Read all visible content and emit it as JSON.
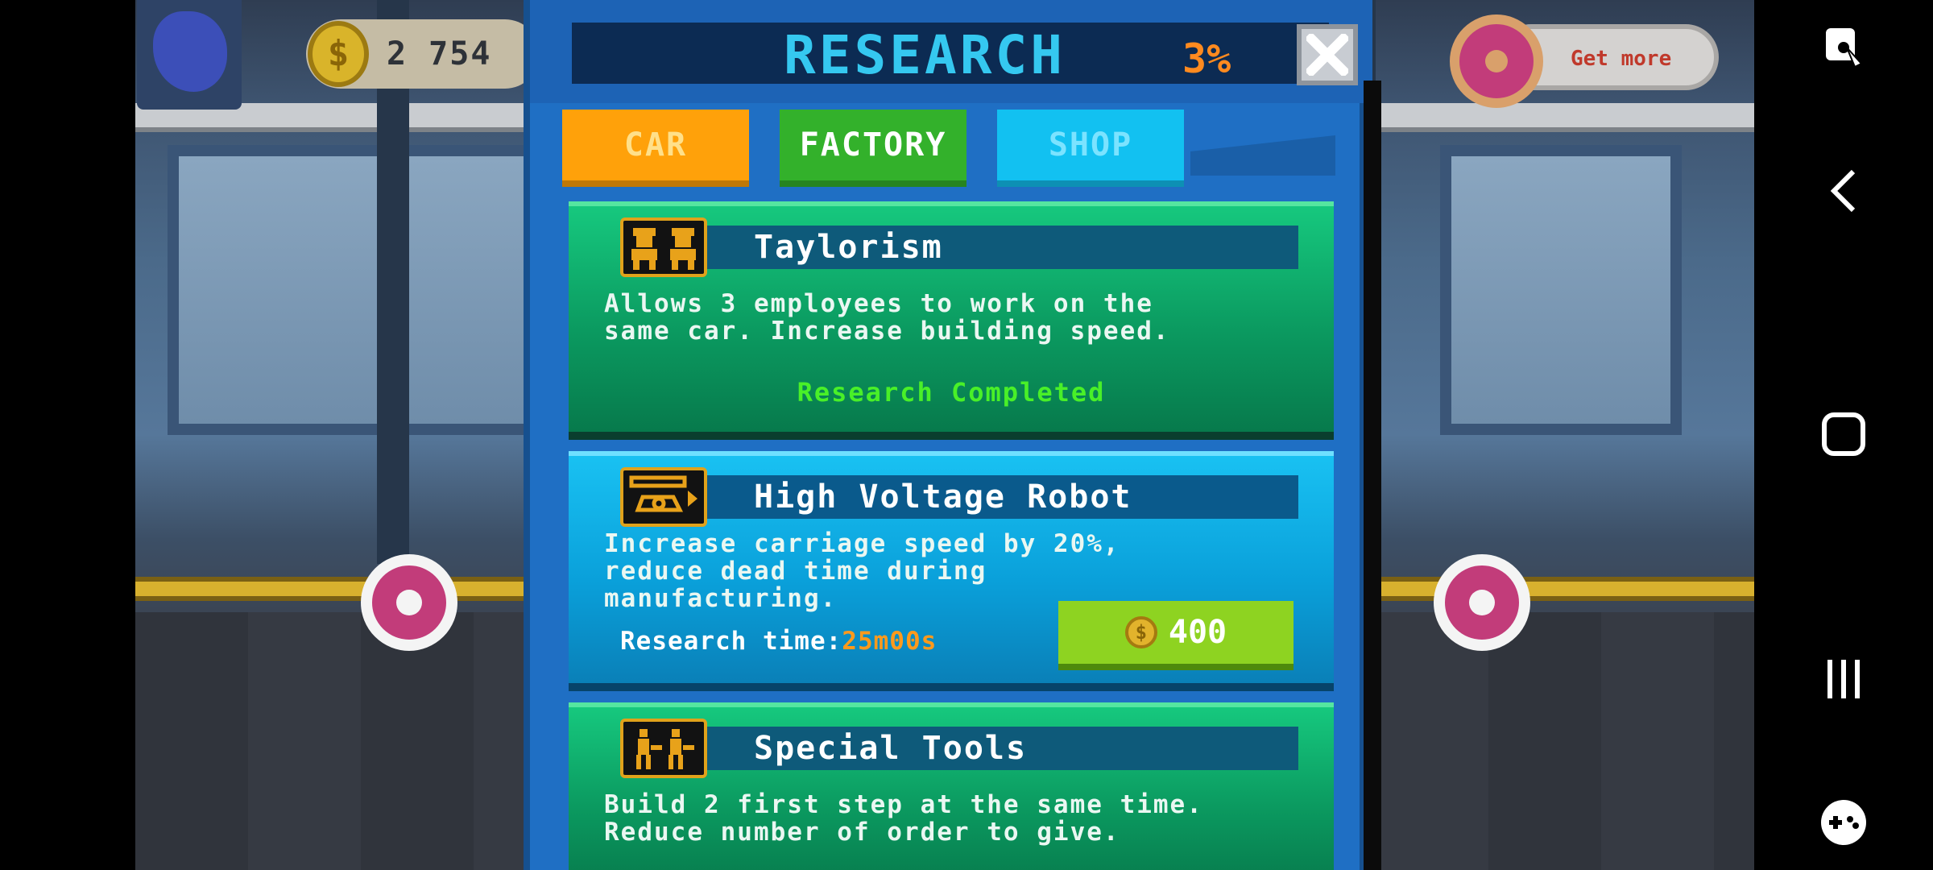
{
  "hud": {
    "coins": "2 754",
    "coin_symbol": "$",
    "get_more_label": "Get more"
  },
  "dialog": {
    "title": "RESEARCH",
    "progress": "3%",
    "close_icon": "close-icon"
  },
  "tabs": [
    {
      "label": "CAR",
      "color": "#ffa10a"
    },
    {
      "label": "FACTORY",
      "color": "#33b12b",
      "active": true
    },
    {
      "label": "SHOP",
      "color": "#12c1f1"
    }
  ],
  "research": [
    {
      "title": "Taylorism",
      "icon": "workers-icon",
      "description": "Allows 3 employees to work on the\nsame car. Increase building speed.",
      "status": "Research Completed"
    },
    {
      "title": "High Voltage Robot",
      "icon": "robot-icon",
      "description": "Increase carriage speed by 20%,\nreduce dead time during\nmanufacturing.",
      "research_time_label": "Research time:",
      "research_time_value": "25m00s",
      "cost": "400",
      "cost_symbol": "$"
    },
    {
      "title": "Special Tools",
      "icon": "tools-icon",
      "description": "Build 2 first step at the same time.\nReduce number of order to give."
    }
  ],
  "navbar": {
    "icons": [
      "screenshot-icon",
      "back-icon",
      "home-icon",
      "recents-icon",
      "game-tools-icon"
    ]
  }
}
